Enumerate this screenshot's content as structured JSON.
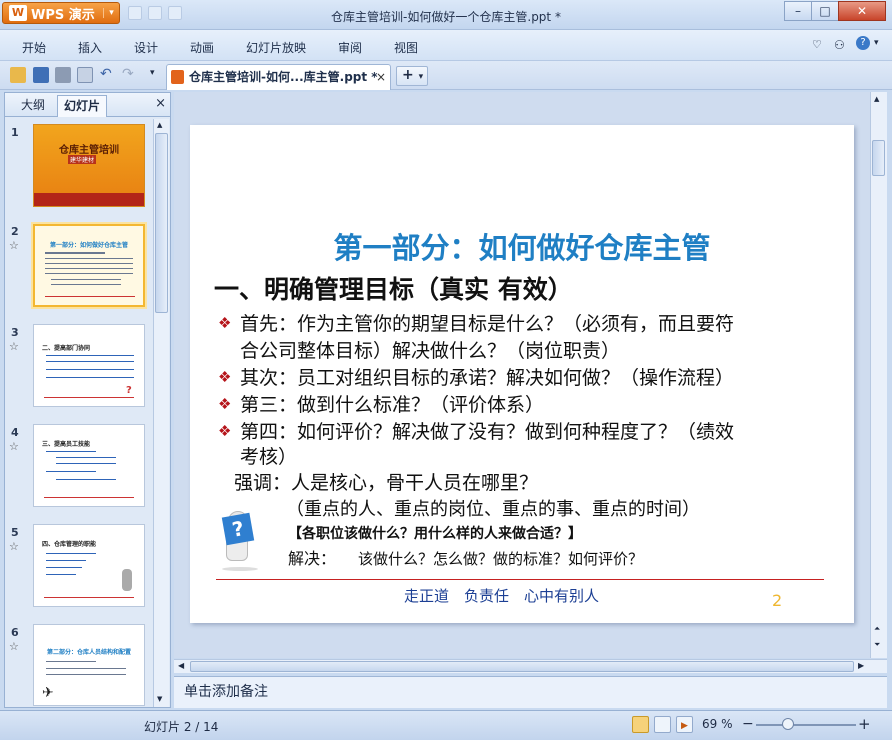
{
  "app": {
    "name": "WPS 演示",
    "title": "仓库主管培训-如何做好一个仓库主管.ppt *"
  },
  "window_controls": {
    "minimize": "–",
    "maximize": "□",
    "close": "✕"
  },
  "menu": [
    "开始",
    "插入",
    "设计",
    "动画",
    "幻灯片放映",
    "审阅",
    "视图"
  ],
  "toolbar": {
    "doc_tab_label": "仓库主管培训-如何...库主管.ppt *",
    "tab_close": "×",
    "new_tab": "+"
  },
  "panel": {
    "tabs": [
      "大纲",
      "幻灯片"
    ],
    "close": "×",
    "thumbs": [
      {
        "num": "1",
        "title": "仓库主管培训",
        "sub": "建华建材"
      },
      {
        "num": "2",
        "title": "第一部分：如何做好仓库主管"
      },
      {
        "num": "3",
        "title": "二、提高部门协同"
      },
      {
        "num": "4",
        "title": "三、提高员工技能"
      },
      {
        "num": "5",
        "title": "四、仓库管理的职能"
      },
      {
        "num": "6",
        "title": "第二部分：仓库人员结构和配置"
      }
    ],
    "star": "☆"
  },
  "slide": {
    "h1": "第一部分：如何做好仓库主管",
    "h2": "一、明确管理目标（真实 有效）",
    "bullet": "❖",
    "lines": [
      "首先：作为主管你的期望目标是什么？（必须有，而且要符",
      "合公司整体目标）解决做什么？（岗位职责）",
      "其次：员工对组织目标的承诺？解决如何做？（操作流程）",
      "第三：做到什么标准？（评价体系）",
      "第四：如何评价？解决做了没有？做到何种程度了？（绩效",
      "考核）",
      "强调：人是核心，骨干人员在哪里？",
      "（重点的人、重点的岗位、重点的事、重点的时间）",
      "【各职位该做什么？用什么样的人来做合适？】",
      "解决：",
      "该做什么？怎么做？做的标准？如何评价？"
    ],
    "footer": "走正道　负责任　心中有别人",
    "page": "2",
    "qmark": "?"
  },
  "notes": {
    "placeholder": "单击添加备注"
  },
  "status": {
    "slide_count": "幻灯片 2 / 14",
    "zoom": "69 %",
    "zoom_out": "−",
    "zoom_in": "+"
  }
}
